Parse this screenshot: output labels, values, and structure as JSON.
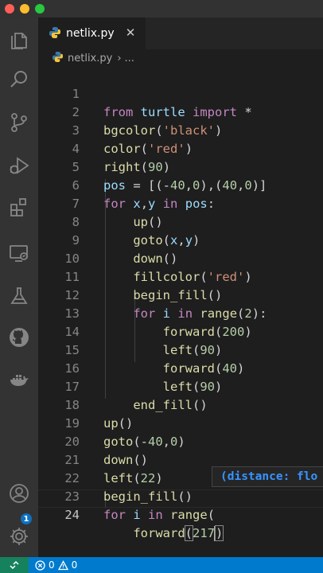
{
  "window": {
    "traffic_lights": [
      "#ff5f57",
      "#febc2e",
      "#28c840"
    ]
  },
  "activity_bar": {
    "icons": [
      "explorer-icon",
      "search-icon",
      "source-control-icon",
      "run-debug-icon",
      "extensions-icon",
      "remote-explorer-icon",
      "testing-icon",
      "github-icon",
      "docker-icon",
      "account-icon",
      "settings-gear-icon"
    ],
    "accounts_badge": "1"
  },
  "tabs": [
    {
      "label": "netlix.py",
      "icon": "python-icon",
      "close": "✕"
    }
  ],
  "breadcrumb": {
    "file": "netlix.py",
    "separator": "›",
    "more": "..."
  },
  "editor": {
    "language": "python",
    "line_numbers": [
      "1",
      "2",
      "3",
      "4",
      "5",
      "6",
      "7",
      "8",
      "9",
      "10",
      "11",
      "12",
      "13",
      "14",
      "15",
      "16",
      "17",
      "18",
      "19",
      "20",
      "21",
      "22",
      "23",
      "24"
    ],
    "lines": [
      "from turtle import *",
      "bgcolor('black')",
      "color('red')",
      "right(90)",
      "pos = [(-40,0),(40,0)]",
      "for x,y in pos:",
      "    up()",
      "    goto(x,y)",
      "    down()",
      "    fillcolor('red')",
      "    begin_fill()",
      "    for i in range(2):",
      "        forward(200)",
      "        left(90)",
      "        forward(40)",
      "        left(90)",
      "    end_fill()",
      "up()",
      "goto(-40,0)",
      "down()",
      "left(22)",
      "begin_fill()",
      "for i in range(",
      "    forward(217)"
    ],
    "parameter_hint": "(distance: flo"
  },
  "status_bar": {
    "remote_icon": "remote-icon",
    "errors": "0",
    "warnings": "0",
    "error_icon": "error-icon",
    "warning_icon": "warning-icon"
  },
  "colors": {
    "keyword": "#c586c0",
    "function": "#dcdcaa",
    "string": "#ce9178",
    "number": "#b5cea8",
    "variable": "#9cdcfe",
    "status_bar": "#007acc",
    "remote_indicator": "#16825d"
  }
}
